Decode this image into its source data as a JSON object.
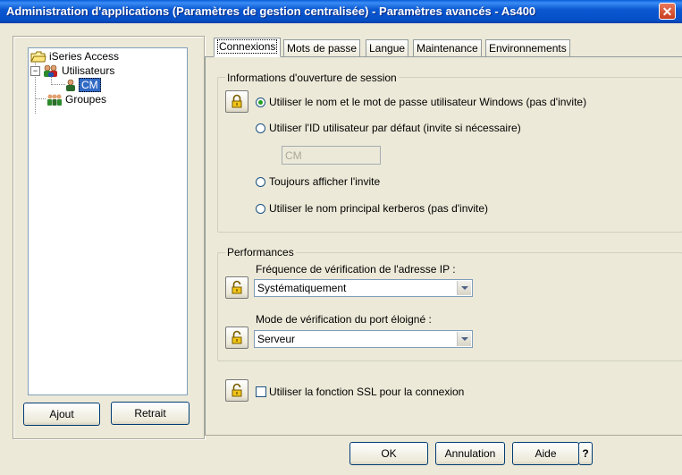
{
  "window": {
    "title": "Administration d'applications (Paramètres de gestion centralisée) - Paramètres avancés - As400"
  },
  "tree": {
    "root": "iSeries Access",
    "users": "Utilisateurs",
    "selected_user": "CM",
    "groups": "Groupes"
  },
  "left_buttons": {
    "add": "Ajout",
    "remove": "Retrait"
  },
  "tabs": [
    "Connexions",
    "Mots de passe",
    "Langue",
    "Maintenance",
    "Environnements"
  ],
  "login_group": {
    "legend": "Informations d'ouverture de session",
    "options": [
      "Utiliser le nom et le mot de passe utilisateur Windows (pas d'invite)",
      "Utiliser l'ID utilisateur par défaut (invite si nécessaire)",
      "Toujours afficher l'invite",
      "Utiliser le nom principal kerberos (pas d'invite)"
    ],
    "selected_index": 0,
    "default_user_id": "CM"
  },
  "performance_group": {
    "legend": "Performances",
    "ip_check_label": "Fréquence de vérification de l'adresse IP :",
    "ip_check_value": "Systématiquement",
    "port_check_label": "Mode de vérification du port éloigné :",
    "port_check_value": "Serveur"
  },
  "ssl": {
    "label": "Utiliser la fonction SSL pour la connexion",
    "checked": false
  },
  "footer": {
    "ok": "OK",
    "cancel": "Annulation",
    "help": "Aide",
    "what": "?"
  },
  "colors": {
    "title_bar": "#0a5fd8",
    "radio_dot": "#21a121",
    "dialog_bg": "#ece9d8"
  }
}
